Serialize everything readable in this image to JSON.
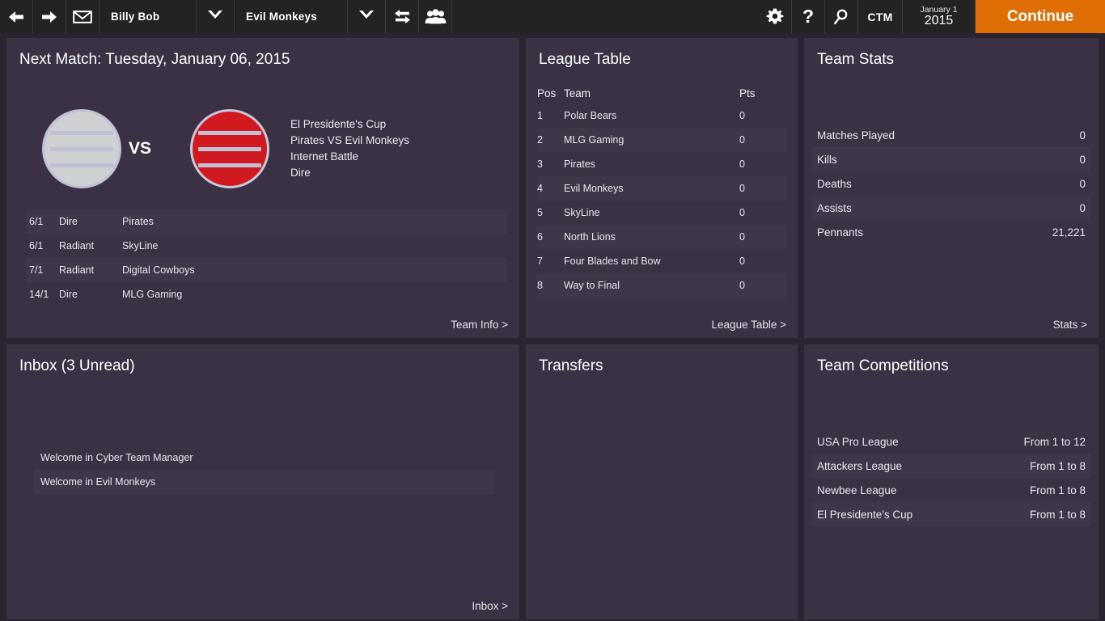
{
  "topbar": {
    "back_icon": "arrow-left-icon",
    "forward_icon": "arrow-right-icon",
    "mail_icon": "mail-icon",
    "manager_name": "Billy Bob",
    "team_name": "Evil Monkeys",
    "caret_icon": "chevron-down-icon",
    "transfer_icon": "swap-arrows-icon",
    "squad_icon": "people-group-icon",
    "settings_icon": "gear-icon",
    "help_icon": "question-mark-icon",
    "search_icon": "magnifier-icon",
    "ctm_label": "CTM",
    "date_top": "January 1",
    "date_bottom": "2015",
    "continue_label": "Continue",
    "accent_color": "#df6f05",
    "bar_color": "#232323"
  },
  "next_match": {
    "title": "Next Match: Tuesday, January 06, 2015",
    "vs_label": "VS",
    "home_logo_color": "#cfd0d2",
    "away_logo_color": "#d11a1f",
    "info_lines": [
      "El Presidente's Cup",
      "Pirates VS Evil Monkeys",
      "Internet Battle",
      "Dire"
    ],
    "odds": [
      {
        "odds": "6/1",
        "side": "Dire",
        "team": "Pirates"
      },
      {
        "odds": "6/1",
        "side": "Radiant",
        "team": "SkyLine"
      },
      {
        "odds": "7/1",
        "side": "Radiant",
        "team": "Digital Cowboys"
      },
      {
        "odds": "14/1",
        "side": "Dire",
        "team": "MLG Gaming"
      }
    ],
    "footer_link": "Team Info >"
  },
  "league_table": {
    "title": "League Table",
    "headers": {
      "pos": "Pos",
      "team": "Team",
      "pts": "Pts"
    },
    "rows": [
      {
        "pos": "1",
        "team": "Polar Bears",
        "pts": "0"
      },
      {
        "pos": "2",
        "team": "MLG Gaming",
        "pts": "0"
      },
      {
        "pos": "3",
        "team": "Pirates",
        "pts": "0"
      },
      {
        "pos": "4",
        "team": "Evil Monkeys",
        "pts": "0"
      },
      {
        "pos": "5",
        "team": "SkyLine",
        "pts": "0"
      },
      {
        "pos": "6",
        "team": "North Lions",
        "pts": "0"
      },
      {
        "pos": "7",
        "team": "Four Blades and Bow",
        "pts": "0"
      },
      {
        "pos": "8",
        "team": "Way to Final",
        "pts": "0"
      }
    ],
    "footer_link": "League Table >"
  },
  "team_stats": {
    "title": "Team Stats",
    "rows": [
      {
        "label": "Matches Played",
        "value": "0"
      },
      {
        "label": "Kills",
        "value": "0"
      },
      {
        "label": "Deaths",
        "value": "0"
      },
      {
        "label": "Assists",
        "value": "0"
      },
      {
        "label": "Pennants",
        "value": "21,221"
      }
    ],
    "footer_link": "Stats >"
  },
  "inbox": {
    "title": "Inbox (3 Unread)",
    "messages": [
      "Welcome in Cyber Team Manager",
      "Welcome in Evil Monkeys"
    ],
    "footer_link": "Inbox >"
  },
  "transfers": {
    "title": "Transfers"
  },
  "team_competitions": {
    "title": "Team Competitions",
    "rows": [
      {
        "label": "USA Pro League",
        "value": "From 1 to 12"
      },
      {
        "label": "Attackers League",
        "value": "From 1 to 8"
      },
      {
        "label": "Newbee League",
        "value": "From 1 to 8"
      },
      {
        "label": "El Presidente's Cup",
        "value": "From 1 to 8"
      }
    ]
  }
}
